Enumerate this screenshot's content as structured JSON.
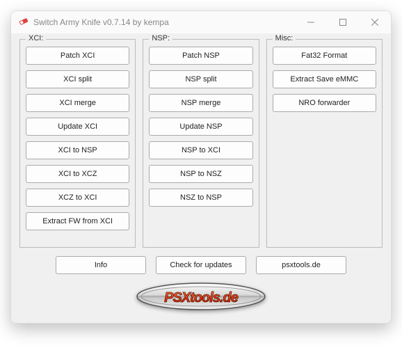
{
  "window": {
    "title": "Switch Army Knife v0.7.14 by kempa"
  },
  "groups": {
    "xci": {
      "legend": "XCI:",
      "buttons": [
        "Patch XCI",
        "XCI split",
        "XCI merge",
        "Update XCI",
        "XCI to NSP",
        "XCI to XCZ",
        "XCZ to XCI",
        "Extract FW from XCI"
      ]
    },
    "nsp": {
      "legend": "NSP:",
      "buttons": [
        "Patch NSP",
        "NSP split",
        "NSP merge",
        "Update NSP",
        "NSP to XCI",
        "NSP to NSZ",
        "NSZ to NSP"
      ]
    },
    "misc": {
      "legend": "Misc:",
      "buttons": [
        "Fat32 Format",
        "Extract Save eMMC",
        "NRO forwarder"
      ]
    }
  },
  "bottom": {
    "info": "Info",
    "check_updates": "Check for updates",
    "psxtools": "psxtools.de"
  },
  "logo_text": "PSXtools.de"
}
